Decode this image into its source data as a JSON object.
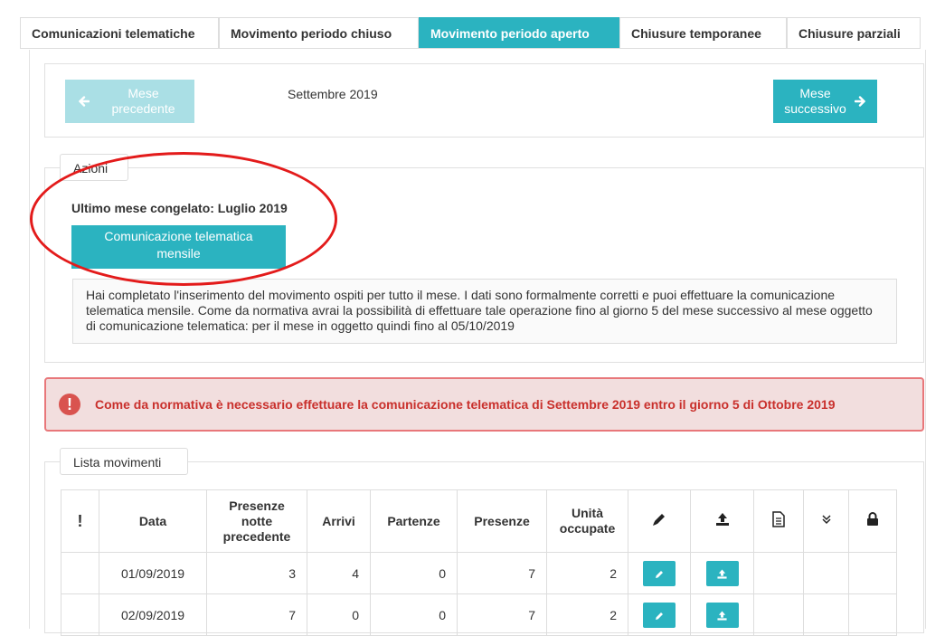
{
  "tabs": [
    {
      "label": "Comunicazioni telematiche",
      "active": false
    },
    {
      "label": "Movimento periodo chiuso",
      "active": false
    },
    {
      "label": "Movimento periodo aperto",
      "active": true
    },
    {
      "label": "Chiusure temporanee",
      "active": false
    },
    {
      "label": "Chiusure parziali",
      "active": false
    }
  ],
  "month_nav": {
    "prev_line1": "Mese",
    "prev_line2": "precedente",
    "current": "Settembre 2019",
    "next_line1": "Mese",
    "next_line2": "successivo"
  },
  "actions": {
    "legend": "Azioni",
    "last_frozen": "Ultimo mese congelato: Luglio 2019",
    "button_line1": "Comunicazione telematica",
    "button_line2": "mensile",
    "info": "Hai completato l'inserimento del movimento ospiti per tutto il mese. I dati sono formalmente corretti e puoi effettuare la comunicazione telematica mensile. Come da normativa avrai la possibilità di effettuare tale operazione fino al giorno 5 del mese successivo al mese oggetto di comunicazione telematica: per il mese in oggetto quindi fino al 05/10/2019"
  },
  "alert": {
    "icon": "exclamation-circle-icon",
    "text": "Come da normativa è necessario effettuare la comunicazione telematica di Settembre 2019 entro il giorno 5 di Ottobre 2019"
  },
  "movements": {
    "legend": "Lista movimenti",
    "headers": {
      "flag": "!",
      "data": "Data",
      "presenze_notte_1": "Presenze",
      "presenze_notte_2": "notte",
      "presenze_notte_3": "precedente",
      "arrivi": "Arrivi",
      "partenze": "Partenze",
      "presenze": "Presenze",
      "unita_1": "Unità",
      "unita_2": "occupate"
    },
    "rows": [
      {
        "data": "01/09/2019",
        "presenze_notte": "3",
        "arrivi": "4",
        "partenze": "0",
        "presenze": "7",
        "unita": "2"
      },
      {
        "data": "02/09/2019",
        "presenze_notte": "7",
        "arrivi": "0",
        "partenze": "0",
        "presenze": "7",
        "unita": "2"
      }
    ]
  },
  "colors": {
    "accent": "#2bb3c0",
    "alert_border": "#e8777a",
    "alert_text": "#c9302c",
    "annotation": "#e31b1b"
  }
}
